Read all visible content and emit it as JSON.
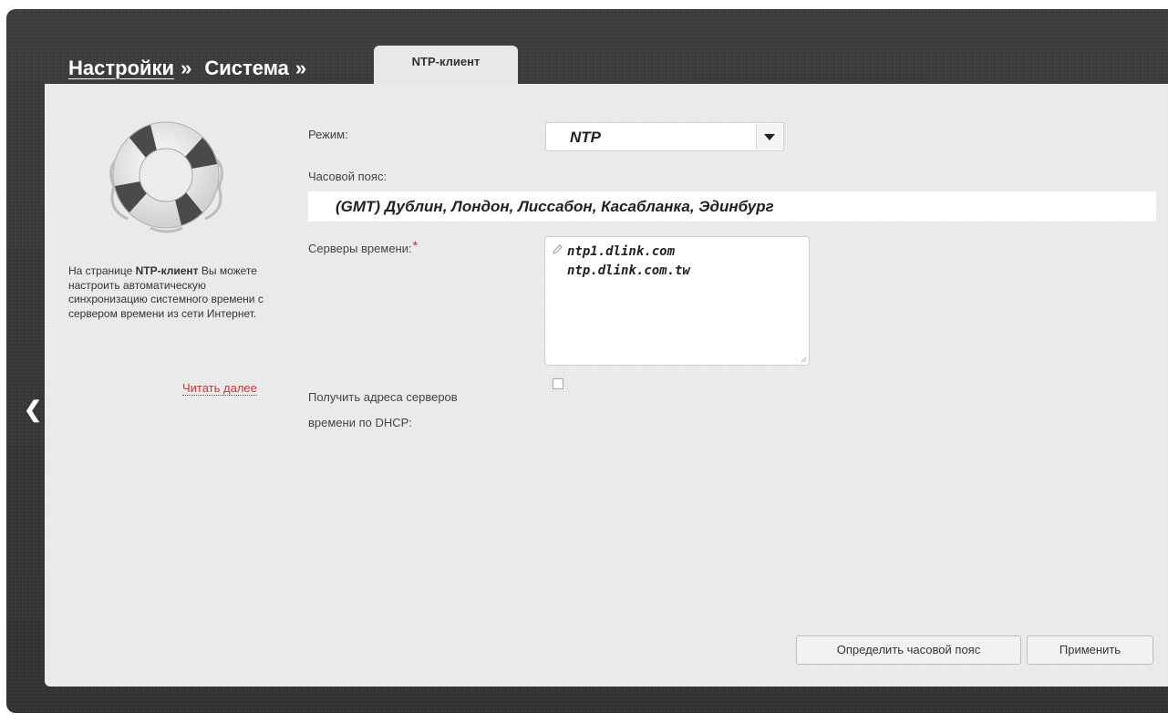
{
  "breadcrumb": {
    "items": [
      {
        "label": "Настройки",
        "separator": "»"
      },
      {
        "label": "Система",
        "separator": "»"
      }
    ]
  },
  "tab": {
    "label": "NTP-клиент"
  },
  "sidebar": {
    "icon": "lifebuoy-icon",
    "help_prefix": "На странице ",
    "help_bold": "NTP-клиент",
    "help_suffix": " Вы можете настроить автоматическую синхронизацию системного времени с сервером времени из сети Интернет.",
    "read_more": "Читать далее"
  },
  "form": {
    "mode": {
      "label": "Режим:",
      "value": "NTP"
    },
    "timezone": {
      "label": "Часовой пояс:",
      "value": "(GMT) Дублин, Лондон, Лиссабон, Касабланка, Эдинбург"
    },
    "servers": {
      "label": "Серверы времени:",
      "required_mark": "*",
      "values": [
        "ntp1.dlink.com",
        "ntp.dlink.com.tw"
      ]
    },
    "dhcp": {
      "label_line1": "Получить адреса серверов",
      "label_line2": "времени по DHCP:",
      "checked": false
    }
  },
  "buttons": {
    "detect_timezone": "Определить часовой пояс",
    "apply": "Применить"
  },
  "nav": {
    "back_icon": "chevron-left-icon",
    "back_glyph": "❮"
  },
  "colors": {
    "frame": "#3a3a3a",
    "panel": "#ececec",
    "required": "#d9261c",
    "link": "#cc3333"
  }
}
